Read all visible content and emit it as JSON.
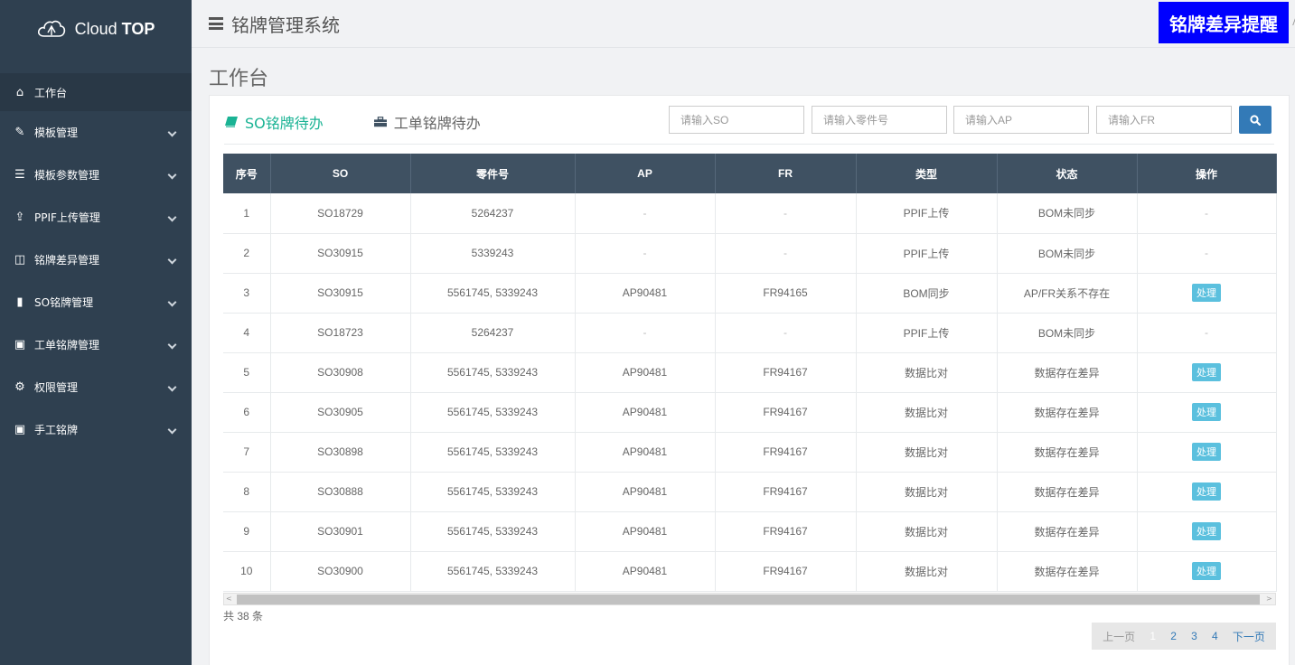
{
  "brand": {
    "name_light": "Cloud",
    "name_bold": "TOP"
  },
  "sidebar": {
    "items": [
      {
        "label": "工作台",
        "icon": "home-icon",
        "active": true,
        "has_chevron": false
      },
      {
        "label": "模板管理",
        "icon": "edit-icon",
        "has_chevron": true
      },
      {
        "label": "模板参数管理",
        "icon": "file-icon",
        "has_chevron": true
      },
      {
        "label": "PPIF上传管理",
        "icon": "upload-icon",
        "has_chevron": true
      },
      {
        "label": "铭牌差异管理",
        "icon": "columns-icon",
        "has_chevron": true
      },
      {
        "label": "SO铭牌管理",
        "icon": "book-icon",
        "has_chevron": true
      },
      {
        "label": "工单铭牌管理",
        "icon": "briefcase-icon",
        "has_chevron": true
      },
      {
        "label": "权限管理",
        "icon": "gear-icon",
        "has_chevron": true
      },
      {
        "label": "手工铭牌",
        "icon": "briefcase-icon",
        "has_chevron": true
      }
    ]
  },
  "header": {
    "title": "铭牌管理系统",
    "alert_badge": "铭牌差异提醒"
  },
  "page": {
    "title": "工作台"
  },
  "tabs": [
    {
      "label": "SO铭牌待办",
      "active": true,
      "icon": "book-icon"
    },
    {
      "label": "工单铭牌待办",
      "active": false,
      "icon": "briefcase-icon"
    }
  ],
  "search": {
    "so_placeholder": "请输入SO",
    "part_placeholder": "请输入零件号",
    "ap_placeholder": "请输入AP",
    "fr_placeholder": "请输入FR"
  },
  "table": {
    "columns": [
      "序号",
      "SO",
      "零件号",
      "AP",
      "FR",
      "类型",
      "状态",
      "操作"
    ],
    "rows": [
      [
        "1",
        "SO18729",
        "5264237",
        "-",
        "-",
        "PPIF上传",
        "BOM未同步",
        "-"
      ],
      [
        "2",
        "SO30915",
        "5339243",
        "-",
        "-",
        "PPIF上传",
        "BOM未同步",
        "-"
      ],
      [
        "3",
        "SO30915",
        "5561745, 5339243",
        "AP90481",
        "FR94165",
        "BOM同步",
        "AP/FR关系不存在",
        "处理"
      ],
      [
        "4",
        "SO18723",
        "5264237",
        "-",
        "-",
        "PPIF上传",
        "BOM未同步",
        "-"
      ],
      [
        "5",
        "SO30908",
        "5561745, 5339243",
        "AP90481",
        "FR94167",
        "数据比对",
        "数据存在差异",
        "处理"
      ],
      [
        "6",
        "SO30905",
        "5561745, 5339243",
        "AP90481",
        "FR94167",
        "数据比对",
        "数据存在差异",
        "处理"
      ],
      [
        "7",
        "SO30898",
        "5561745, 5339243",
        "AP90481",
        "FR94167",
        "数据比对",
        "数据存在差异",
        "处理"
      ],
      [
        "8",
        "SO30888",
        "5561745, 5339243",
        "AP90481",
        "FR94167",
        "数据比对",
        "数据存在差异",
        "处理"
      ],
      [
        "9",
        "SO30901",
        "5561745, 5339243",
        "AP90481",
        "FR94167",
        "数据比对",
        "数据存在差异",
        "处理"
      ],
      [
        "10",
        "SO30900",
        "5561745, 5339243",
        "AP90481",
        "FR94167",
        "数据比对",
        "数据存在差异",
        "处理"
      ]
    ]
  },
  "footer": {
    "total": "共 38 条"
  },
  "pager": {
    "prev": "上一页",
    "pages": [
      "1",
      "2",
      "3",
      "4"
    ],
    "current": "1",
    "next": "下一页"
  },
  "colors": {
    "sidebar": "#2f4050",
    "active_tab": "#1ab394",
    "thead": "#3f5162",
    "alert": "#0000ff",
    "process_btn": "#5bc0de",
    "search_btn": "#337ab7"
  }
}
